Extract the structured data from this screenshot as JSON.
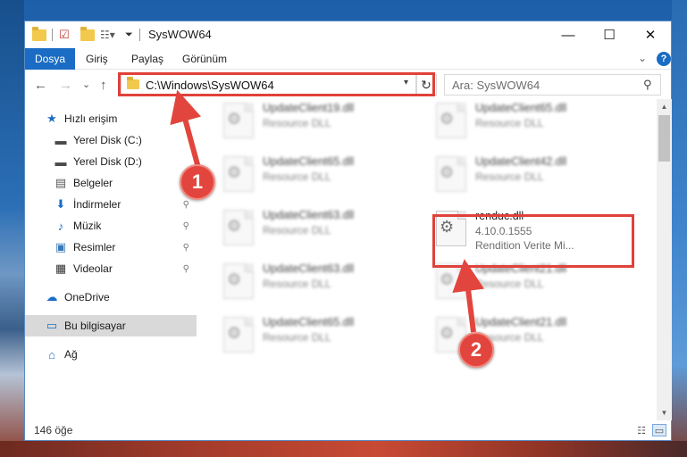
{
  "window": {
    "title": "SysWOW64",
    "controls": {
      "minimize": "—",
      "maximize": "☐",
      "close": "✕"
    }
  },
  "ribbon": {
    "tabs": [
      {
        "label": "Dosya",
        "active": true
      },
      {
        "label": "Giriş"
      },
      {
        "label": "Paylaş"
      },
      {
        "label": "Görünüm"
      }
    ],
    "help": "?"
  },
  "nav": {
    "back": "←",
    "forward": "→",
    "recent": "⌄",
    "up": "↑",
    "address": "C:\\Windows\\SysWOW64",
    "refresh": "↻",
    "search_placeholder": "Ara: SysWOW64",
    "search_icon": "⚲"
  },
  "sidebar": {
    "items": [
      {
        "label": "Hızlı erişim",
        "icon": "star-icon",
        "glyph": "★",
        "color": "#1a6cc4"
      },
      {
        "label": "Yerel Disk (C:)",
        "icon": "drive-icon",
        "glyph": "▬",
        "color": "#4a4a4a"
      },
      {
        "label": "Yerel Disk (D:)",
        "icon": "drive-icon",
        "glyph": "▬",
        "color": "#4a4a4a"
      },
      {
        "label": "Belgeler",
        "icon": "documents-icon",
        "glyph": "▤",
        "color": "#5a5a5a"
      },
      {
        "label": "İndirmeler",
        "icon": "download-icon",
        "glyph": "⬇",
        "color": "#1a6cc4",
        "pinned": true
      },
      {
        "label": "Müzik",
        "icon": "music-icon",
        "glyph": "♪",
        "color": "#1a6cc4",
        "pinned": true
      },
      {
        "label": "Resimler",
        "icon": "pictures-icon",
        "glyph": "▣",
        "color": "#3b7ab8",
        "pinned": true
      },
      {
        "label": "Videolar",
        "icon": "video-icon",
        "glyph": "▦",
        "color": "#333333",
        "pinned": true
      },
      {
        "label": "OneDrive",
        "icon": "cloud-icon",
        "glyph": "☁",
        "color": "#1a6cc4"
      },
      {
        "label": "Bu bilgisayar",
        "icon": "computer-icon",
        "glyph": "▭",
        "color": "#1a6cc4",
        "selected": true
      },
      {
        "label": "Ağ",
        "icon": "network-icon",
        "glyph": "⌂",
        "color": "#1a6cc4"
      }
    ],
    "pin_glyph": "📌"
  },
  "files": {
    "left": [
      {
        "name": "UpdateClient19.dll",
        "type": "Resource DLL"
      },
      {
        "name": "UpdateClient65.dll",
        "type": "Resource DLL"
      },
      {
        "name": "UpdateClient63.dll",
        "type": "Resource DLL"
      },
      {
        "name": "UpdateClient63.dll",
        "type": "Resource DLL"
      },
      {
        "name": "UpdateClient65.dll",
        "type": "Resource DLL"
      }
    ],
    "right": [
      {
        "name": "UpdateClient65.dll",
        "type": "Resource DLL"
      },
      {
        "name": "UpdateClient42.dll",
        "type": "Resource DLL"
      },
      {
        "name": "renduc.dll",
        "version": "4.10.0.1555",
        "company": "Rendition Verite Mi...",
        "highlighted": true
      },
      {
        "name": "UpdateClient21.dll",
        "type": "Resource DLL"
      },
      {
        "name": "UpdateClient21.dll",
        "type": "Resource DLL"
      }
    ]
  },
  "status": {
    "count": "146 öğe"
  },
  "annotations": {
    "step1": "1",
    "step2": "2",
    "highlight_color": "#e0413a"
  }
}
